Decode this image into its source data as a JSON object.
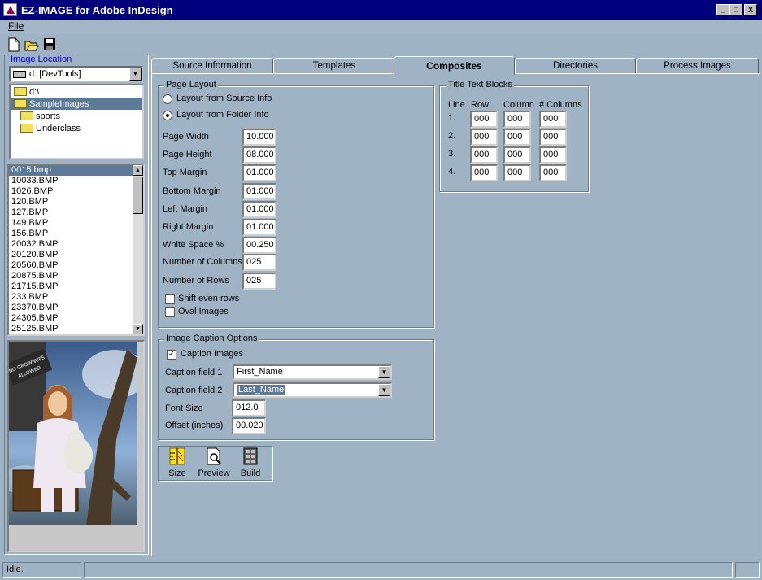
{
  "window": {
    "title": "EZ-IMAGE for Adobe InDesign",
    "min": "_",
    "max": "□",
    "close": "X"
  },
  "menu": {
    "file": "File"
  },
  "left": {
    "group_label": "Image Location",
    "drive": "d: [DevTools]",
    "tree": [
      {
        "label": "d:\\",
        "selected": false,
        "indent": 0
      },
      {
        "label": "SampleImages",
        "selected": true,
        "indent": 0
      },
      {
        "label": "sports",
        "selected": false,
        "indent": 1
      },
      {
        "label": "Underclass",
        "selected": false,
        "indent": 1
      }
    ],
    "files": [
      "0015.bmp",
      "10033.BMP",
      "1026.BMP",
      "120.BMP",
      "127.BMP",
      "149.BMP",
      "156.BMP",
      "20032.BMP",
      "20120.BMP",
      "20560.BMP",
      "20875.BMP",
      "21715.BMP",
      "233.BMP",
      "23370.BMP",
      "24305.BMP",
      "25125.BMP"
    ],
    "preview_sign": "NO GROWNUPS ALLOWED"
  },
  "tabs": [
    "Source Information",
    "Templates",
    "Composites",
    "Directories",
    "Process Images"
  ],
  "page_layout": {
    "title": "Page Layout",
    "radio_source": "Layout from Source Info",
    "radio_folder": "Layout from Folder Info",
    "fields": [
      {
        "label": "Page Width",
        "value": "10.000"
      },
      {
        "label": "Page Height",
        "value": "08.000"
      },
      {
        "label": "Top Margin",
        "value": "01.000"
      },
      {
        "label": "Bottom Margin",
        "value": "01.000"
      },
      {
        "label": "Left Margin",
        "value": "01.000"
      },
      {
        "label": "Right Margin",
        "value": "01.000"
      },
      {
        "label": "White Space %",
        "value": "00.250"
      },
      {
        "label": "Number of Columns",
        "value": "025"
      },
      {
        "label": "Number of Rows",
        "value": "025"
      }
    ],
    "shift_even": "Shift even rows",
    "oval": "Oval Images"
  },
  "title_blocks": {
    "title": "Title Text Blocks",
    "headers": [
      "Line",
      "Row",
      "Column",
      "# Columns"
    ],
    "rows": [
      {
        "line": "1.",
        "row": "000",
        "col": "000",
        "ncols": "000"
      },
      {
        "line": "2.",
        "row": "000",
        "col": "000",
        "ncols": "000"
      },
      {
        "line": "3.",
        "row": "000",
        "col": "000",
        "ncols": "000"
      },
      {
        "line": "4.",
        "row": "000",
        "col": "000",
        "ncols": "000"
      }
    ]
  },
  "caption": {
    "title": "Image Caption Options",
    "caption_images": "Caption Images",
    "field1_label": "Caption field 1",
    "field1_value": "First_Name",
    "field2_label": "Caption field 2",
    "field2_value": "Last_Name",
    "font_size_label": "Font Size",
    "font_size": "012.0",
    "offset_label": "Offset (inches)",
    "offset": "00.020"
  },
  "actions": {
    "size": "Size",
    "preview": "Preview",
    "build": "Build"
  },
  "status": {
    "text": "Idle."
  }
}
